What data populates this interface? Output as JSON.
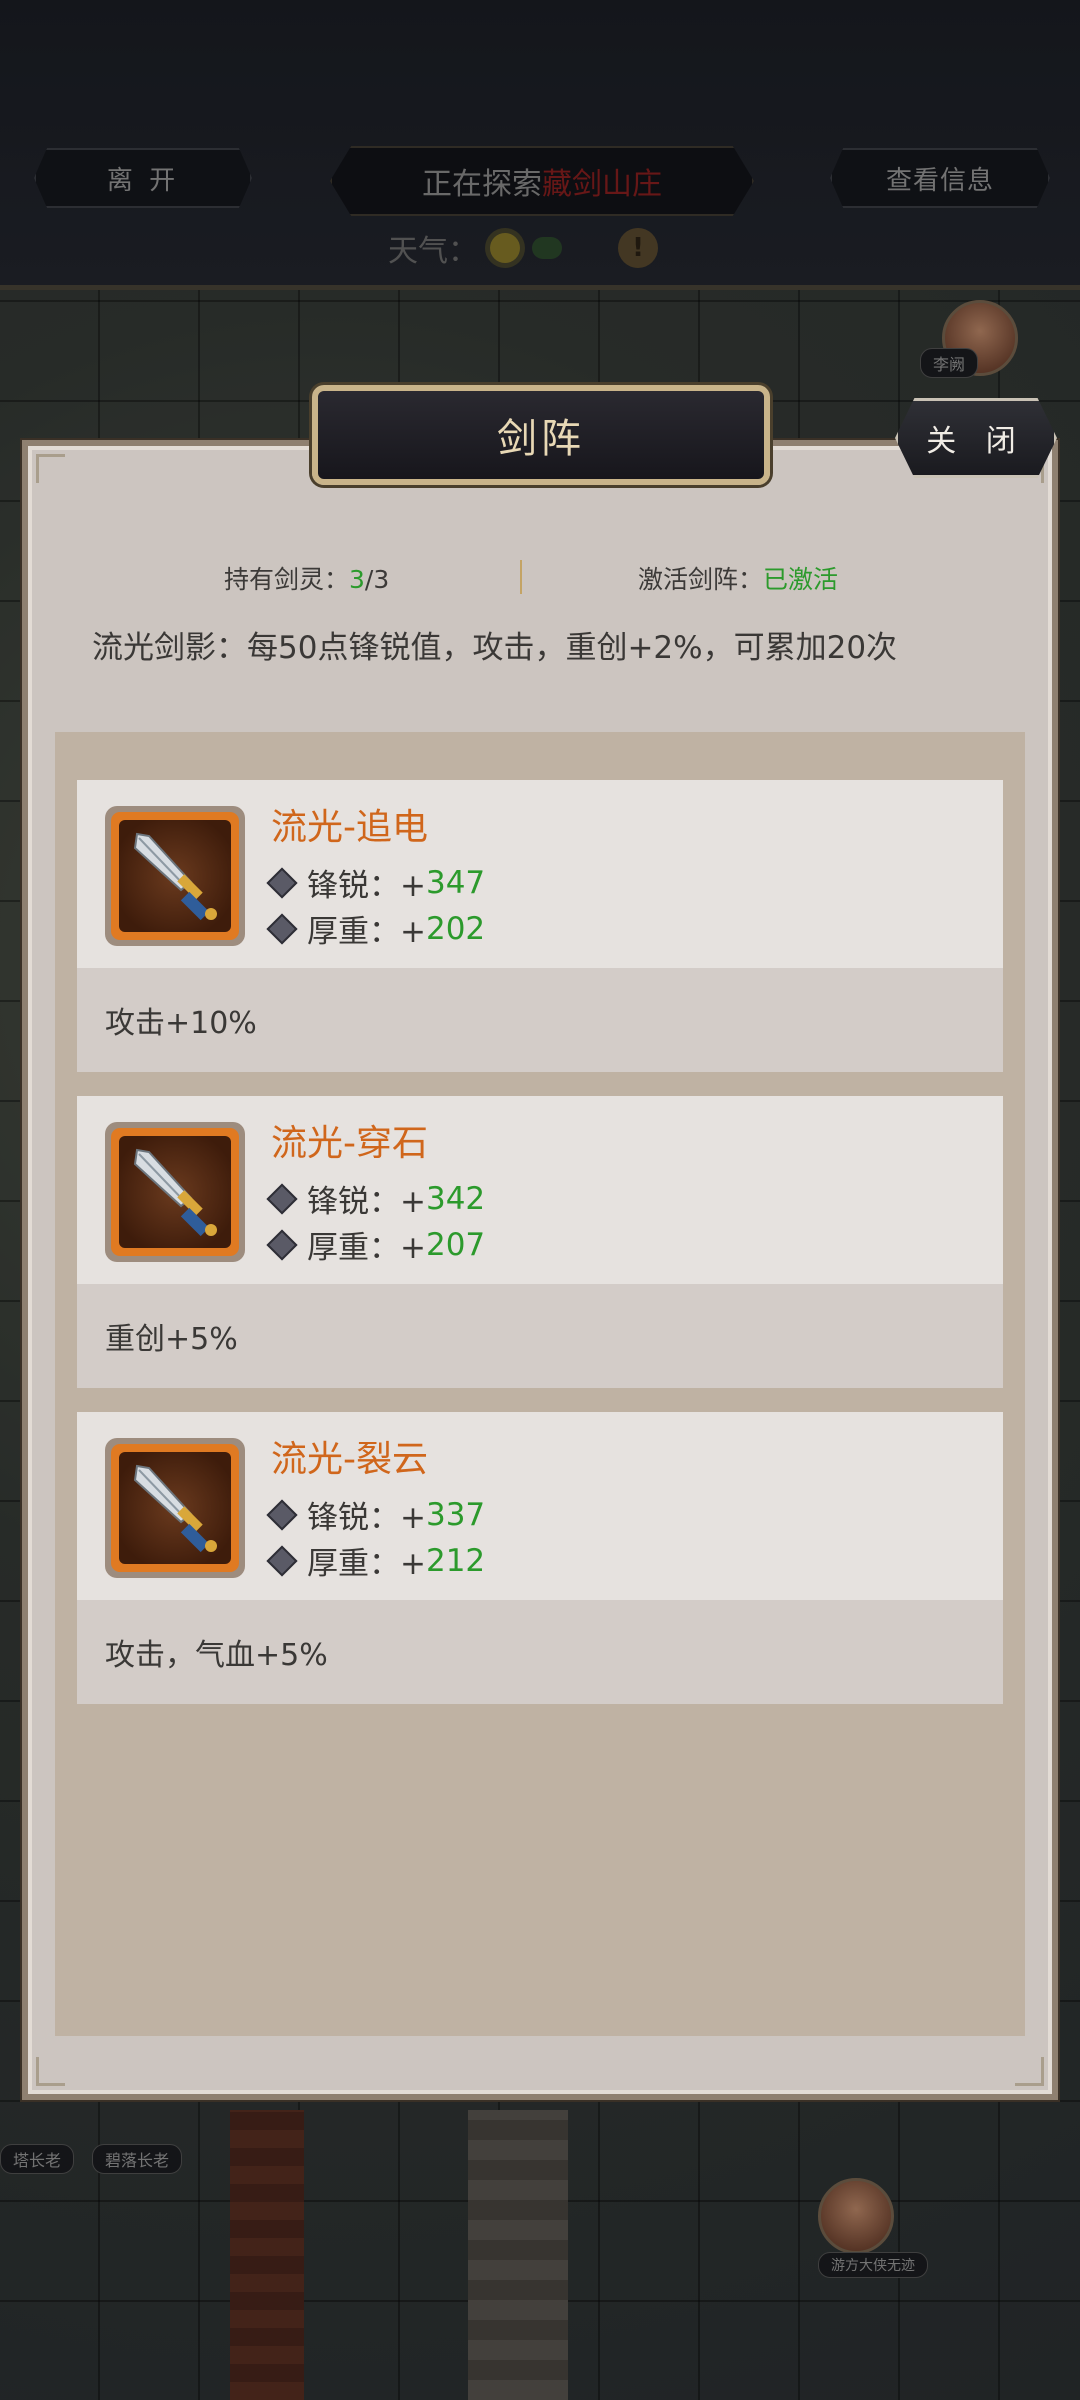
{
  "top": {
    "leave_button": "离 开",
    "explore_prefix": "正在探索",
    "explore_place": "藏剑山庄",
    "info_button": "查看信息",
    "weather_label": "天气：",
    "warn_mark": "!"
  },
  "npcs": {
    "npc1": "李阙",
    "npc2": "碧落长老",
    "npc3": "塔长老",
    "npc4": "游方大侠无迹"
  },
  "modal": {
    "title": "剑阵",
    "close_button": "关 闭",
    "hold_label": "持有剑灵：",
    "hold_current": "3",
    "hold_total": "/3",
    "active_label": "激活剑阵：",
    "active_value": "已激活",
    "description": "流光剑影：每50点锋锐值，攻击，重创+2%，可累加20次"
  },
  "swords": [
    {
      "name": "流光-追电",
      "sharp_label": "锋锐：+",
      "sharp_value": "347",
      "heavy_label": "厚重：+",
      "heavy_value": "202",
      "bonus": "攻击+10%"
    },
    {
      "name": "流光-穿石",
      "sharp_label": "锋锐：+",
      "sharp_value": "342",
      "heavy_label": "厚重：+",
      "heavy_value": "207",
      "bonus": "重创+5%"
    },
    {
      "name": "流光-裂云",
      "sharp_label": "锋锐：+",
      "sharp_value": "337",
      "heavy_label": "厚重：+",
      "heavy_value": "212",
      "bonus": "攻击，气血+5%"
    }
  ],
  "colors": {
    "accent_orange": "#d0661b",
    "value_green": "#2c9a2c",
    "title_gold": "#e8d8b5"
  }
}
